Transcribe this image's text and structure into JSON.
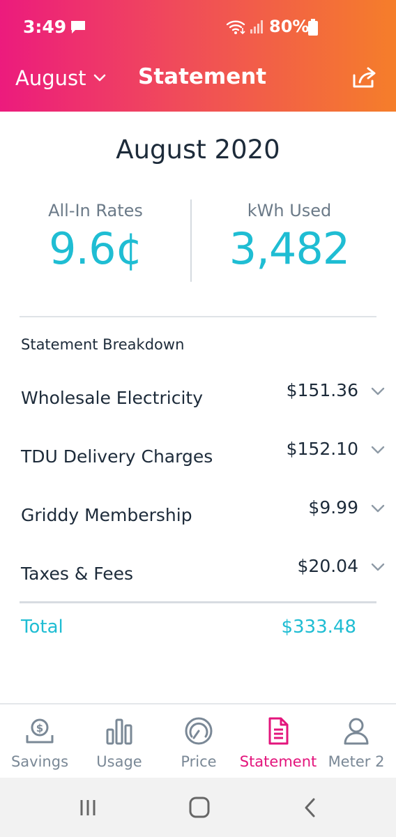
{
  "status_bar": {
    "time": "3:49",
    "battery": "80%"
  },
  "header": {
    "month": "August",
    "title": "Statement"
  },
  "statement": {
    "period": "August 2020",
    "metrics": [
      {
        "label": "All-In Rates",
        "value": "9.6¢"
      },
      {
        "label": "kWh Used",
        "value": "3,482"
      }
    ],
    "breakdown_title": "Statement Breakdown",
    "items": [
      {
        "label": "Wholesale Electricity",
        "amount": "$151.36"
      },
      {
        "label": "TDU Delivery Charges",
        "amount": "$152.10"
      },
      {
        "label": "Griddy Membership",
        "amount": "$9.99"
      },
      {
        "label": "Taxes & Fees",
        "amount": "$20.04"
      }
    ],
    "total_label": "Total",
    "total_amount": "$333.48"
  },
  "tabs": [
    {
      "label": "Savings",
      "icon": "piggy-coin-icon"
    },
    {
      "label": "Usage",
      "icon": "bar-chart-icon"
    },
    {
      "label": "Price",
      "icon": "gauge-icon"
    },
    {
      "label": "Statement",
      "icon": "document-icon",
      "active": true
    },
    {
      "label": "Meter 2",
      "icon": "user-icon"
    }
  ],
  "colors": {
    "accent": "#1fbdd3",
    "brand_pink": "#e3157c",
    "gradient_start": "#ec1b7d",
    "gradient_end": "#f57e2a"
  }
}
